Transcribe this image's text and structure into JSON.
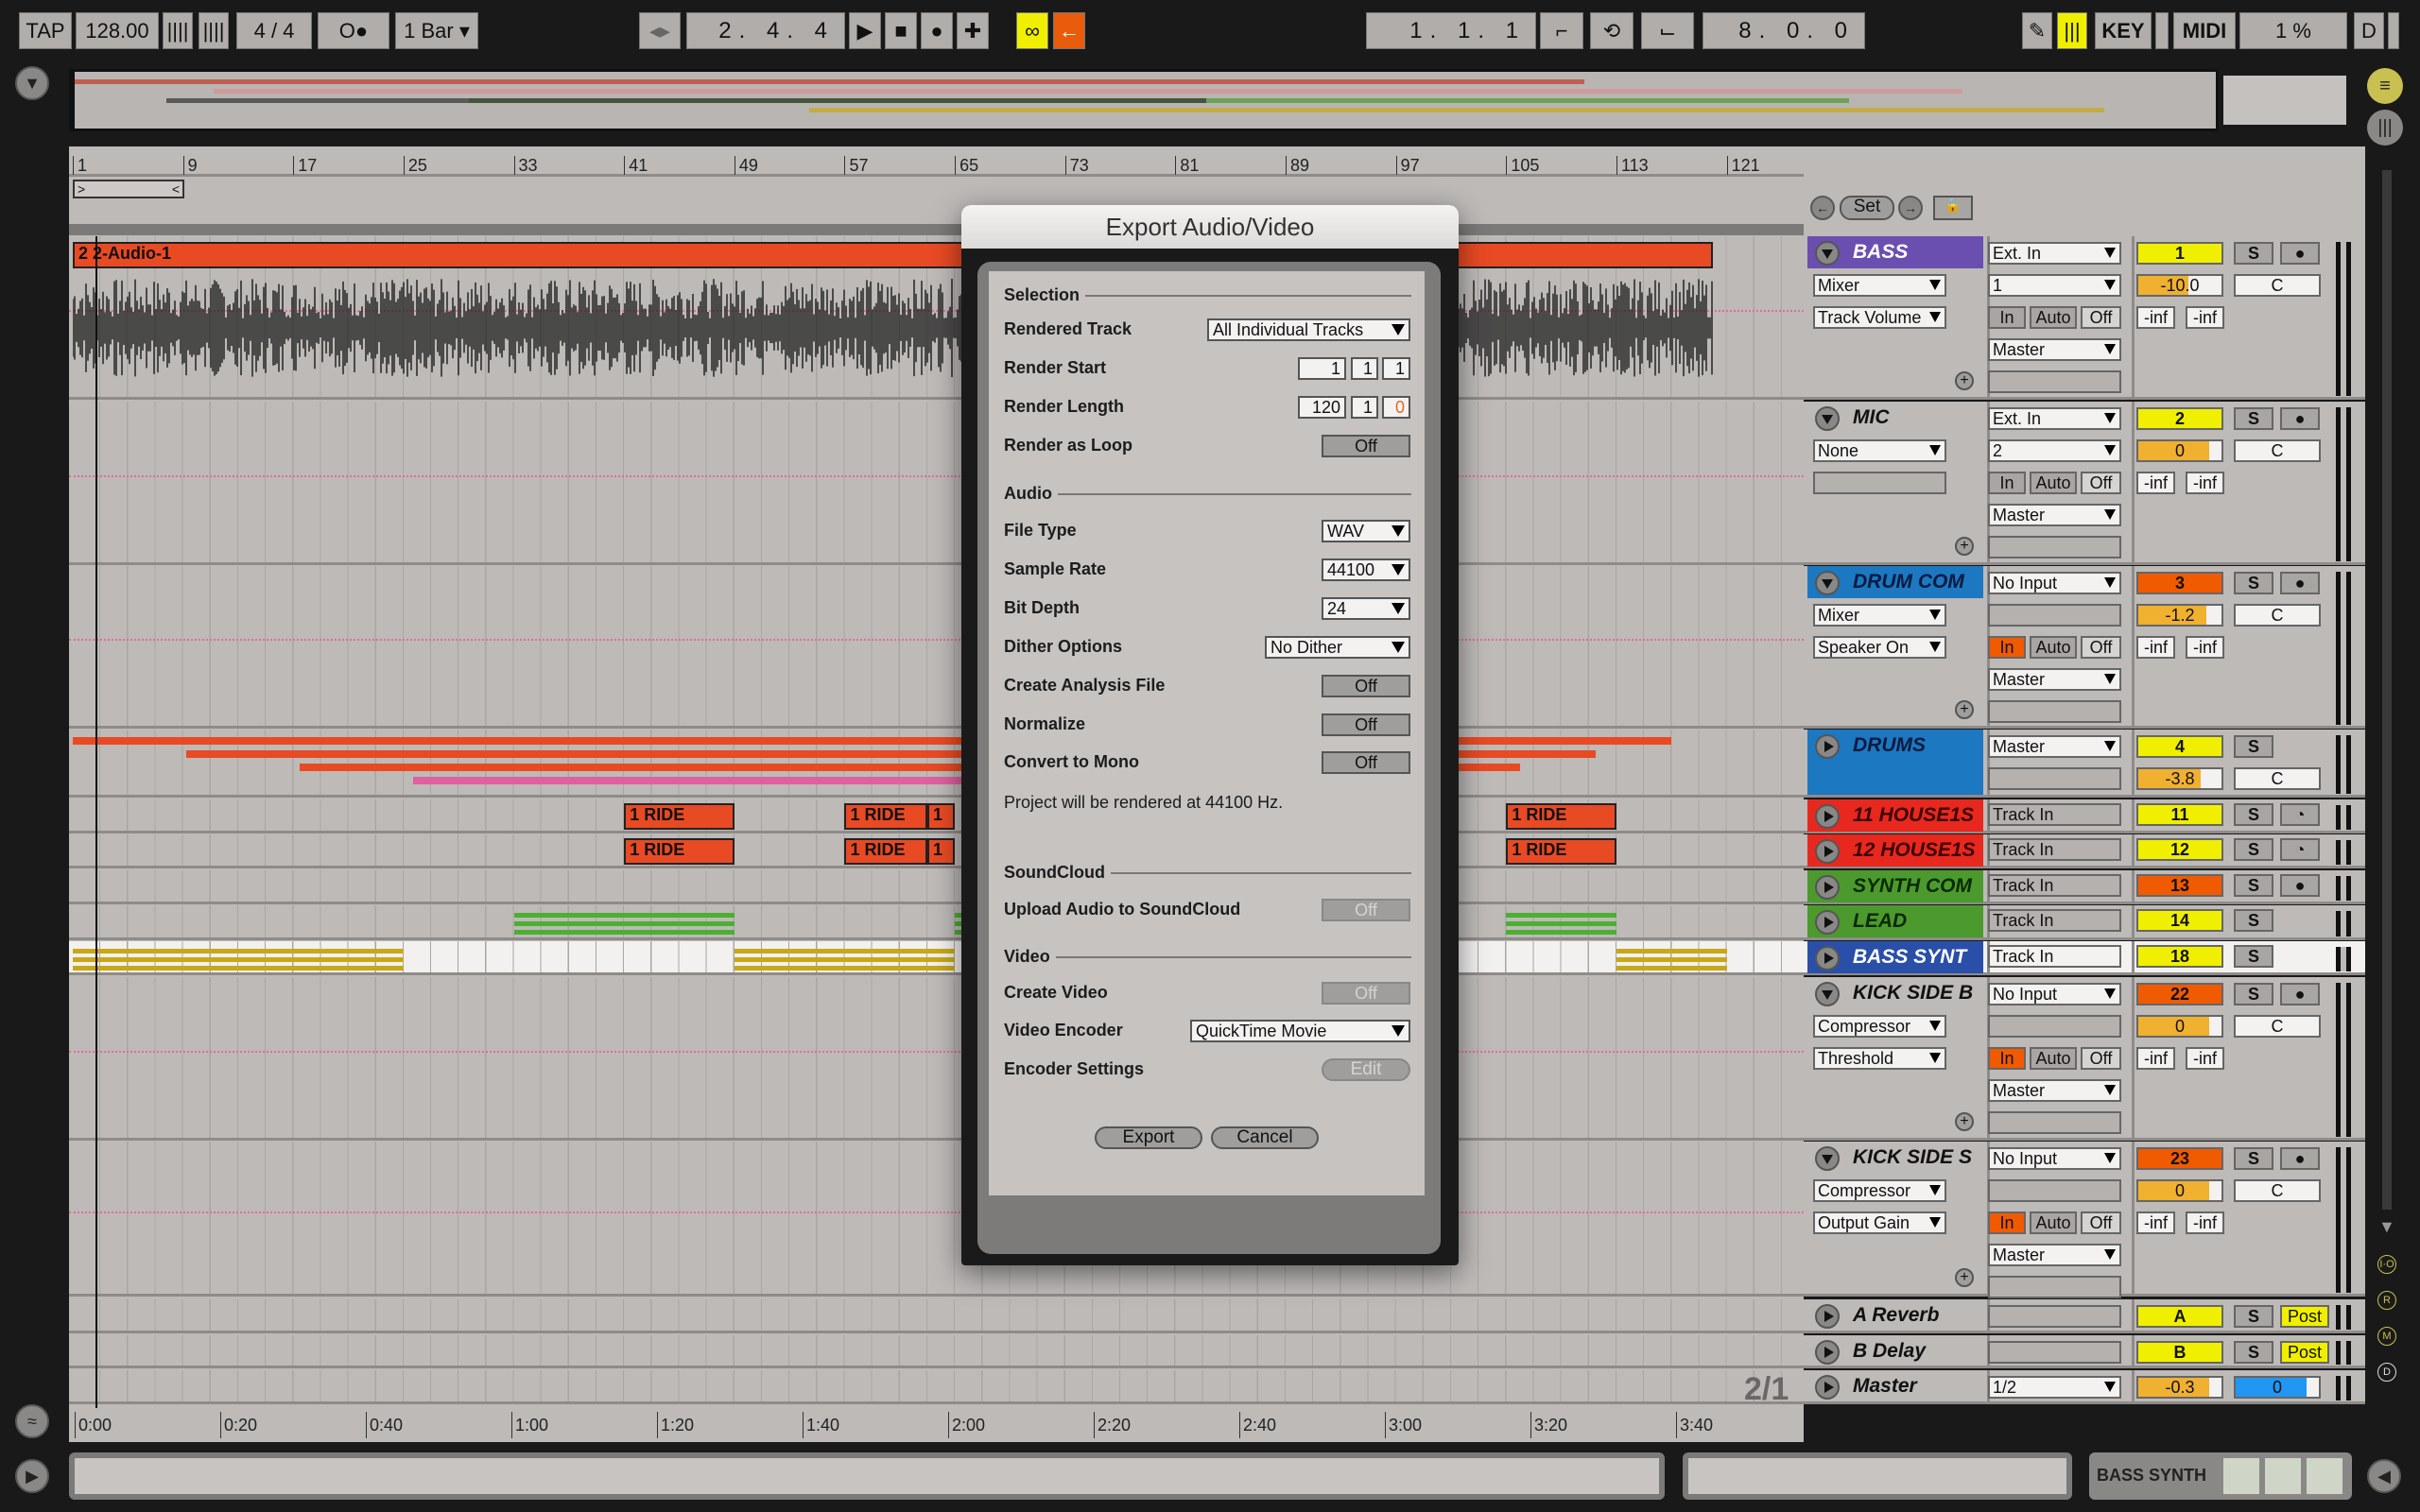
{
  "transport": {
    "tap": "TAP",
    "tempo": "128.00",
    "signature": "4 / 4",
    "metro_label": "O●",
    "quantize": "1 Bar",
    "position": "2. 4. 4",
    "loop_start": "1. 1. 1",
    "loop_length": "8. 0. 0",
    "key": "KEY",
    "midi": "MIDI",
    "cpu": "1 %",
    "d": "D"
  },
  "ruler": {
    "bars": [
      "1",
      "9",
      "17",
      "25",
      "33",
      "41",
      "49",
      "57",
      "65",
      "73",
      "81",
      "89",
      "97",
      "105",
      "113",
      "121"
    ],
    "times": [
      "0:00",
      "0:20",
      "0:40",
      "1:00",
      "1:20",
      "1:40",
      "2:00",
      "2:20",
      "2:40",
      "3:00",
      "3:20",
      "3:40"
    ],
    "grid_label": "2/1"
  },
  "locators": {
    "set": "Set"
  },
  "colors": {
    "yellow": "#f0ef00",
    "orange": "#f05a00",
    "clip_red": "#e84a24",
    "purple": "#6a4fb0",
    "blue": "#1c78c0",
    "red": "#e8281e",
    "green": "#4c9a2e",
    "dark_blue": "#2a4fa8",
    "volume": "#f0b030",
    "cue_blue": "#2196f3"
  },
  "monitor_labels": [
    "In",
    "Auto",
    "Off"
  ],
  "tracks": [
    {
      "name": "BASS",
      "color": "#6a4fb0",
      "text": "#ffffff",
      "open": true,
      "device": "Mixer",
      "param": "Track Volume",
      "input": "Ext. In",
      "channel": "1",
      "monitor": "Auto",
      "output": "Master",
      "number": "1",
      "number_color": "#f0ef00",
      "volume": "-10.0",
      "volume_level": 0.6,
      "pan": "C",
      "send_a": "-inf",
      "send_b": "-inf",
      "arm": "dot"
    },
    {
      "name": "MIC",
      "color": "",
      "text": "#111111",
      "open": true,
      "device": "None",
      "param": "",
      "input": "Ext. In",
      "channel": "2",
      "monitor": "Auto",
      "output": "Master",
      "number": "2",
      "number_color": "#f0ef00",
      "volume": "0",
      "volume_level": 0.85,
      "pan": "C",
      "send_a": "-inf",
      "send_b": "-inf",
      "arm": "dot"
    },
    {
      "name": "DRUM COM",
      "color": "#1c78c0",
      "text": "#0a1a40",
      "open": true,
      "device": "Mixer",
      "param": "Speaker On",
      "input": "No Input",
      "channel": "",
      "monitor": "In",
      "output": "Master",
      "number": "3",
      "number_color": "#f05a00",
      "volume": "-1.2",
      "volume_level": 0.82,
      "pan": "C",
      "send_a": "-inf",
      "send_b": "-inf",
      "arm": "dot"
    },
    {
      "name": "DRUMS",
      "color": "#1c78c0",
      "text": "#0a1a40",
      "group": true,
      "output": "Master",
      "number": "4",
      "number_color": "#f0ef00",
      "volume": "-3.8",
      "volume_level": 0.75,
      "pan": "C"
    },
    {
      "name": "11 HOUSE1S",
      "color": "#e8281e",
      "text": "#3a0000",
      "input": "Track In",
      "number": "11",
      "number_color": "#f0ef00",
      "arm": "clock"
    },
    {
      "name": "12 HOUSE1S",
      "color": "#e8281e",
      "text": "#3a0000",
      "input": "Track In",
      "number": "12",
      "number_color": "#f0ef00",
      "arm": "clock"
    },
    {
      "name": "SYNTH COM",
      "color": "#4c9a2e",
      "text": "#0a2a00",
      "input": "Track In",
      "number": "13",
      "number_color": "#f05a00",
      "arm": "dot"
    },
    {
      "name": "LEAD",
      "color": "#4c9a2e",
      "text": "#0a2a00",
      "input": "Track In",
      "number": "14",
      "number_color": "#f0ef00",
      "arm": ""
    },
    {
      "name": "BASS SYNT",
      "color": "#2a4fa8",
      "text": "#ffffff",
      "input": "Track In",
      "number": "18",
      "number_color": "#f0ef00",
      "arm": "",
      "selected": true
    },
    {
      "name": "KICK SIDE B",
      "color": "",
      "text": "#111111",
      "open": true,
      "device": "Compressor",
      "param": "Threshold",
      "input": "No Input",
      "channel": "",
      "monitor": "In",
      "output": "Master",
      "number": "22",
      "number_color": "#f05a00",
      "volume": "0",
      "volume_level": 0.85,
      "pan": "C",
      "send_a": "-inf",
      "send_b": "-inf",
      "arm": "dot"
    },
    {
      "name": "KICK SIDE S",
      "color": "",
      "text": "#111111",
      "open": true,
      "device": "Compressor",
      "param": "Output Gain",
      "input": "No Input",
      "channel": "",
      "monitor": "In",
      "output": "Master",
      "number": "23",
      "number_color": "#f05a00",
      "volume": "0",
      "volume_level": 0.85,
      "pan": "C",
      "send_a": "-inf",
      "send_b": "-inf",
      "arm": "dot"
    },
    {
      "name": "A Reverb",
      "return": true,
      "number": "A",
      "post": "Post"
    },
    {
      "name": "B Delay",
      "return": true,
      "number": "B",
      "post": "Post"
    },
    {
      "name": "Master",
      "master": true,
      "output": "1/2",
      "volume": "-0.3",
      "volume_level": 0.85,
      "cue": "0",
      "cue_level": 0.85
    }
  ],
  "clips": [
    {
      "lane": 0,
      "name": "2 2-Audio-1",
      "start": 1,
      "end": 120,
      "color": "#e84a24",
      "kind": "audio"
    },
    {
      "lane": 3,
      "start": 1,
      "end": 117,
      "color": "#e84a24",
      "kind": "bar"
    },
    {
      "lane": 4,
      "name": "1 RIDE",
      "start": 41,
      "end": 49,
      "color": "#e84a24"
    },
    {
      "lane": 4,
      "name": "1 RIDE",
      "start": 57,
      "end": 63,
      "color": "#e84a24"
    },
    {
      "lane": 4,
      "name": "1",
      "start": 63,
      "end": 65,
      "color": "#e84a24"
    },
    {
      "lane": 4,
      "name": "1 RIDE",
      "start": 105,
      "end": 113,
      "color": "#e84a24"
    },
    {
      "lane": 5,
      "name": "1 RIDE",
      "start": 41,
      "end": 49,
      "color": "#e84a24"
    },
    {
      "lane": 5,
      "name": "1 RIDE",
      "start": 57,
      "end": 63,
      "color": "#e84a24"
    },
    {
      "lane": 5,
      "name": "1",
      "start": 63,
      "end": 65,
      "color": "#e84a24"
    },
    {
      "lane": 5,
      "name": "1 RIDE",
      "start": 105,
      "end": 113,
      "color": "#e84a24"
    },
    {
      "lane": 7,
      "start": 33,
      "end": 49,
      "color": "#4caf30",
      "kind": "midi"
    },
    {
      "lane": 7,
      "start": 65,
      "end": 66,
      "color": "#4caf30",
      "kind": "midi"
    },
    {
      "lane": 7,
      "start": 105,
      "end": 113,
      "color": "#4caf30",
      "kind": "midi"
    },
    {
      "lane": 8,
      "start": 1,
      "end": 25,
      "color": "#c8a818",
      "kind": "midi"
    },
    {
      "lane": 8,
      "start": 49,
      "end": 65,
      "color": "#c8a818",
      "kind": "midi"
    },
    {
      "lane": 8,
      "start": 113,
      "end": 121,
      "color": "#c8a818",
      "kind": "midi"
    }
  ],
  "dialog": {
    "title": "Export Audio/Video",
    "selection": "Selection",
    "rendered_track_label": "Rendered Track",
    "rendered_track": "All Individual Tracks",
    "render_start_label": "Render Start",
    "render_start": [
      "1",
      "1",
      "1"
    ],
    "render_length_label": "Render Length",
    "render_length": [
      "120",
      "1",
      "0"
    ],
    "render_loop_label": "Render as Loop",
    "render_loop": "Off",
    "audio": "Audio",
    "file_type_label": "File Type",
    "file_type": "WAV",
    "sample_rate_label": "Sample Rate",
    "sample_rate": "44100",
    "bit_depth_label": "Bit Depth",
    "bit_depth": "24",
    "dither_label": "Dither Options",
    "dither": "No Dither",
    "analysis_label": "Create Analysis File",
    "analysis": "Off",
    "normalize_label": "Normalize",
    "normalize": "Off",
    "mono_label": "Convert to Mono",
    "mono": "Off",
    "info": "Project will be rendered at 44100 Hz.",
    "soundcloud": "SoundCloud",
    "upload_label": "Upload Audio to SoundCloud",
    "upload": "Off",
    "video": "Video",
    "create_video_label": "Create Video",
    "create_video": "Off",
    "encoder_label": "Video Encoder",
    "encoder": "QuickTime Movie",
    "encoder_settings_label": "Encoder Settings",
    "edit": "Edit",
    "export": "Export",
    "cancel": "Cancel"
  },
  "status": {
    "selected_track": "BASS SYNTH"
  }
}
